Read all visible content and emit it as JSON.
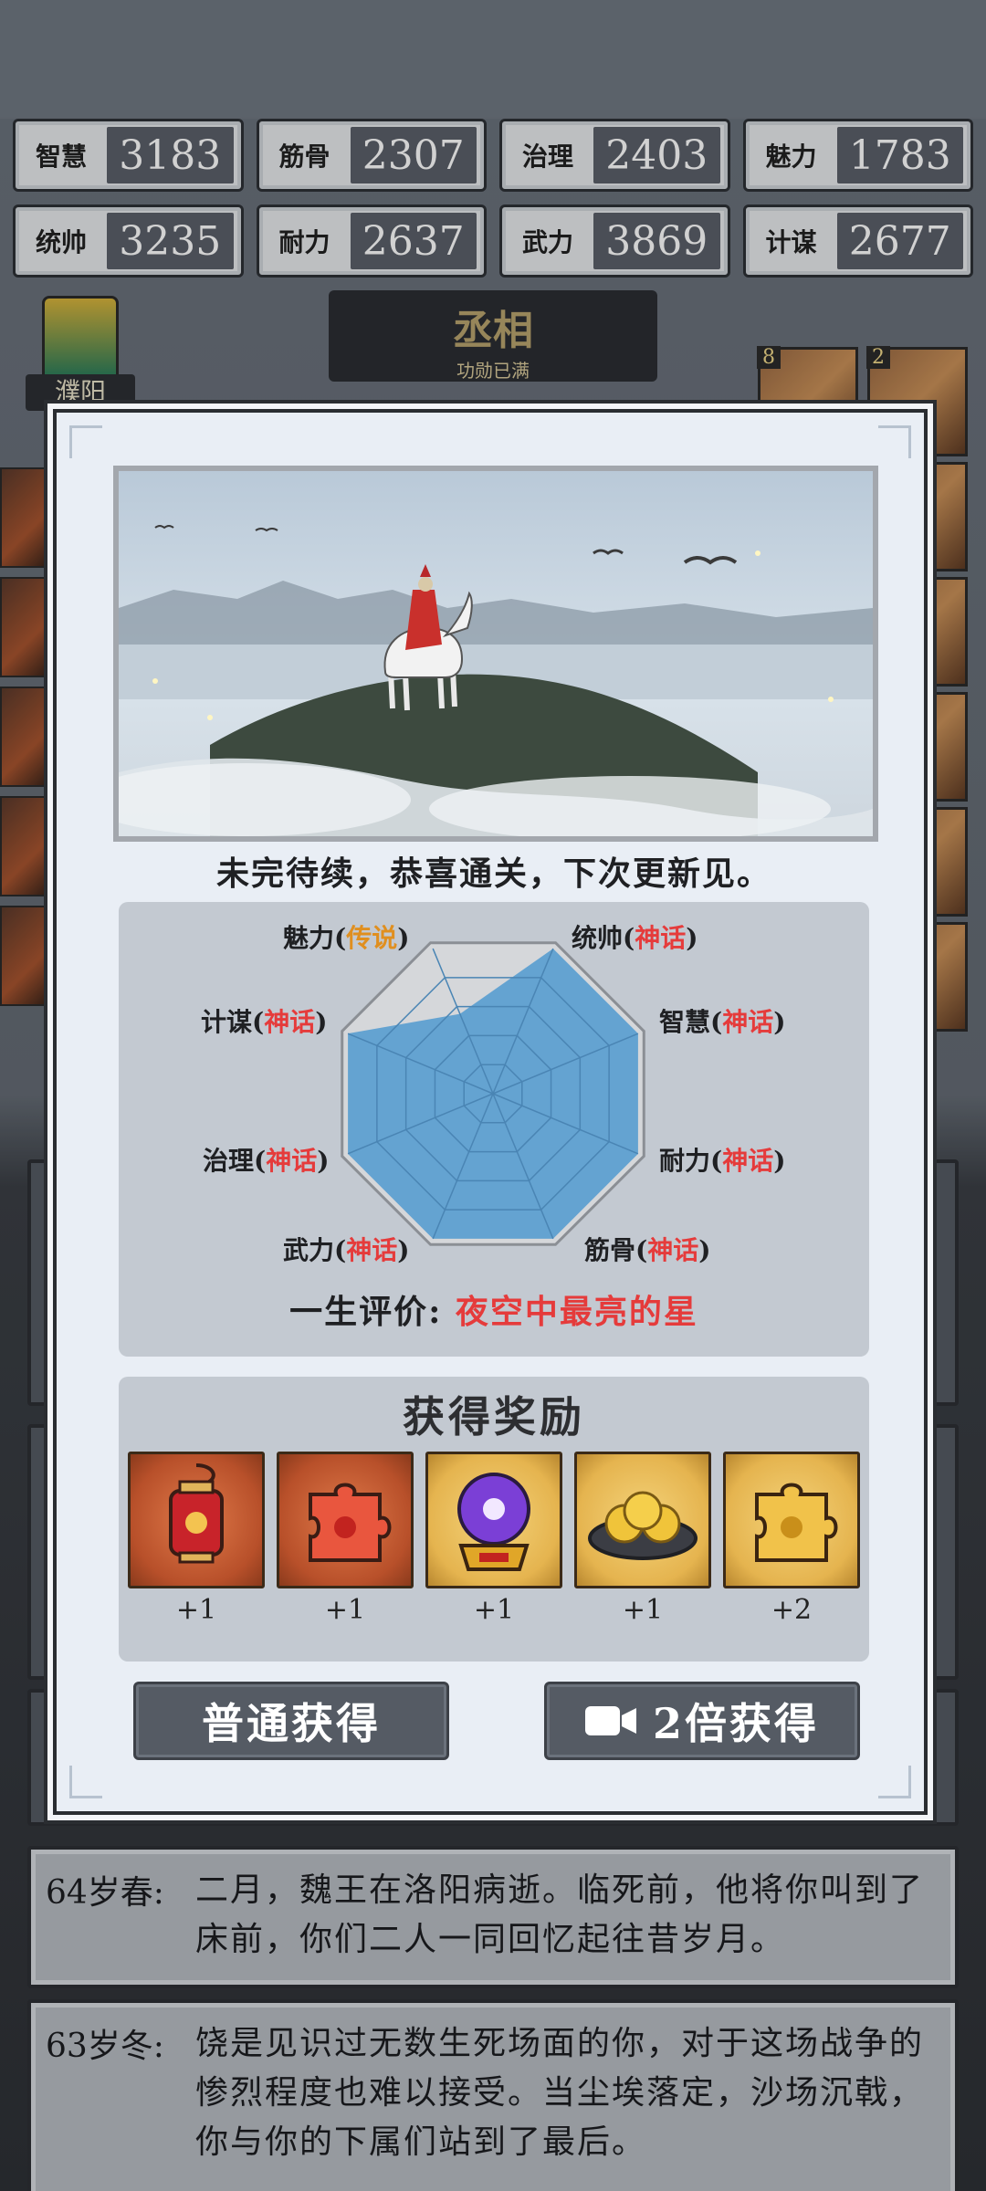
{
  "stats": [
    {
      "name": "智慧",
      "value": "3183"
    },
    {
      "name": "筋骨",
      "value": "2307"
    },
    {
      "name": "治理",
      "value": "2403"
    },
    {
      "name": "魅力",
      "value": "1783"
    },
    {
      "name": "统帅",
      "value": "3235"
    },
    {
      "name": "耐力",
      "value": "2637"
    },
    {
      "name": "武力",
      "value": "3869"
    },
    {
      "name": "计谋",
      "value": "2677"
    }
  ],
  "title_plate": {
    "title": "丞相",
    "subtitle": "功勋已满"
  },
  "city": {
    "name": "濮阳"
  },
  "portrait_badges": [
    "8",
    "2"
  ],
  "modal": {
    "ending_text": "未完待续，恭喜通关，下次更新见。",
    "radar": {
      "labels": [
        {
          "name": "统帅",
          "grade": "神话",
          "grade_type": "myth"
        },
        {
          "name": "智慧",
          "grade": "神话",
          "grade_type": "myth"
        },
        {
          "name": "耐力",
          "grade": "神话",
          "grade_type": "myth"
        },
        {
          "name": "筋骨",
          "grade": "神话",
          "grade_type": "myth"
        },
        {
          "name": "武力",
          "grade": "神话",
          "grade_type": "myth"
        },
        {
          "name": "治理",
          "grade": "神话",
          "grade_type": "myth"
        },
        {
          "name": "计谋",
          "grade": "神话",
          "grade_type": "myth"
        },
        {
          "name": "魅力",
          "grade": "传说",
          "grade_type": "legend"
        }
      ],
      "values": [
        1.0,
        1.0,
        1.0,
        1.0,
        1.0,
        1.0,
        1.0,
        0.55
      ],
      "fill_color": "#5a9ed0",
      "colors": {
        "myth": "#e53b3b",
        "legend": "#e08f1f"
      }
    },
    "life_eval": {
      "label": "一生评价:",
      "value": "夜空中最亮的星"
    },
    "rewards": {
      "title": "获得奖励",
      "items": [
        {
          "icon": "lantern-icon",
          "count": "+1",
          "bg": "red"
        },
        {
          "icon": "puzzle-piece-red-icon",
          "count": "+1",
          "bg": "red"
        },
        {
          "icon": "crystal-ball-icon",
          "count": "+1",
          "bg": "gold"
        },
        {
          "icon": "sesame-buns-icon",
          "count": "+1",
          "bg": "gold"
        },
        {
          "icon": "puzzle-piece-gold-icon",
          "count": "+2",
          "bg": "gold"
        }
      ]
    },
    "buttons": {
      "normal": "普通获得",
      "double": "2倍获得"
    }
  },
  "log": [
    {
      "age": "64岁春:",
      "text": "二月，魏王在洛阳病逝。临死前，他将你叫到了床前，你们二人一同回忆起往昔岁月。"
    },
    {
      "age": "63岁冬:",
      "text": "饶是见识过无数生死场面的你，对于这场战争的惨烈程度也难以接受。当尘埃落定，沙场沉戟，你与你的下属们站到了最后。"
    }
  ]
}
